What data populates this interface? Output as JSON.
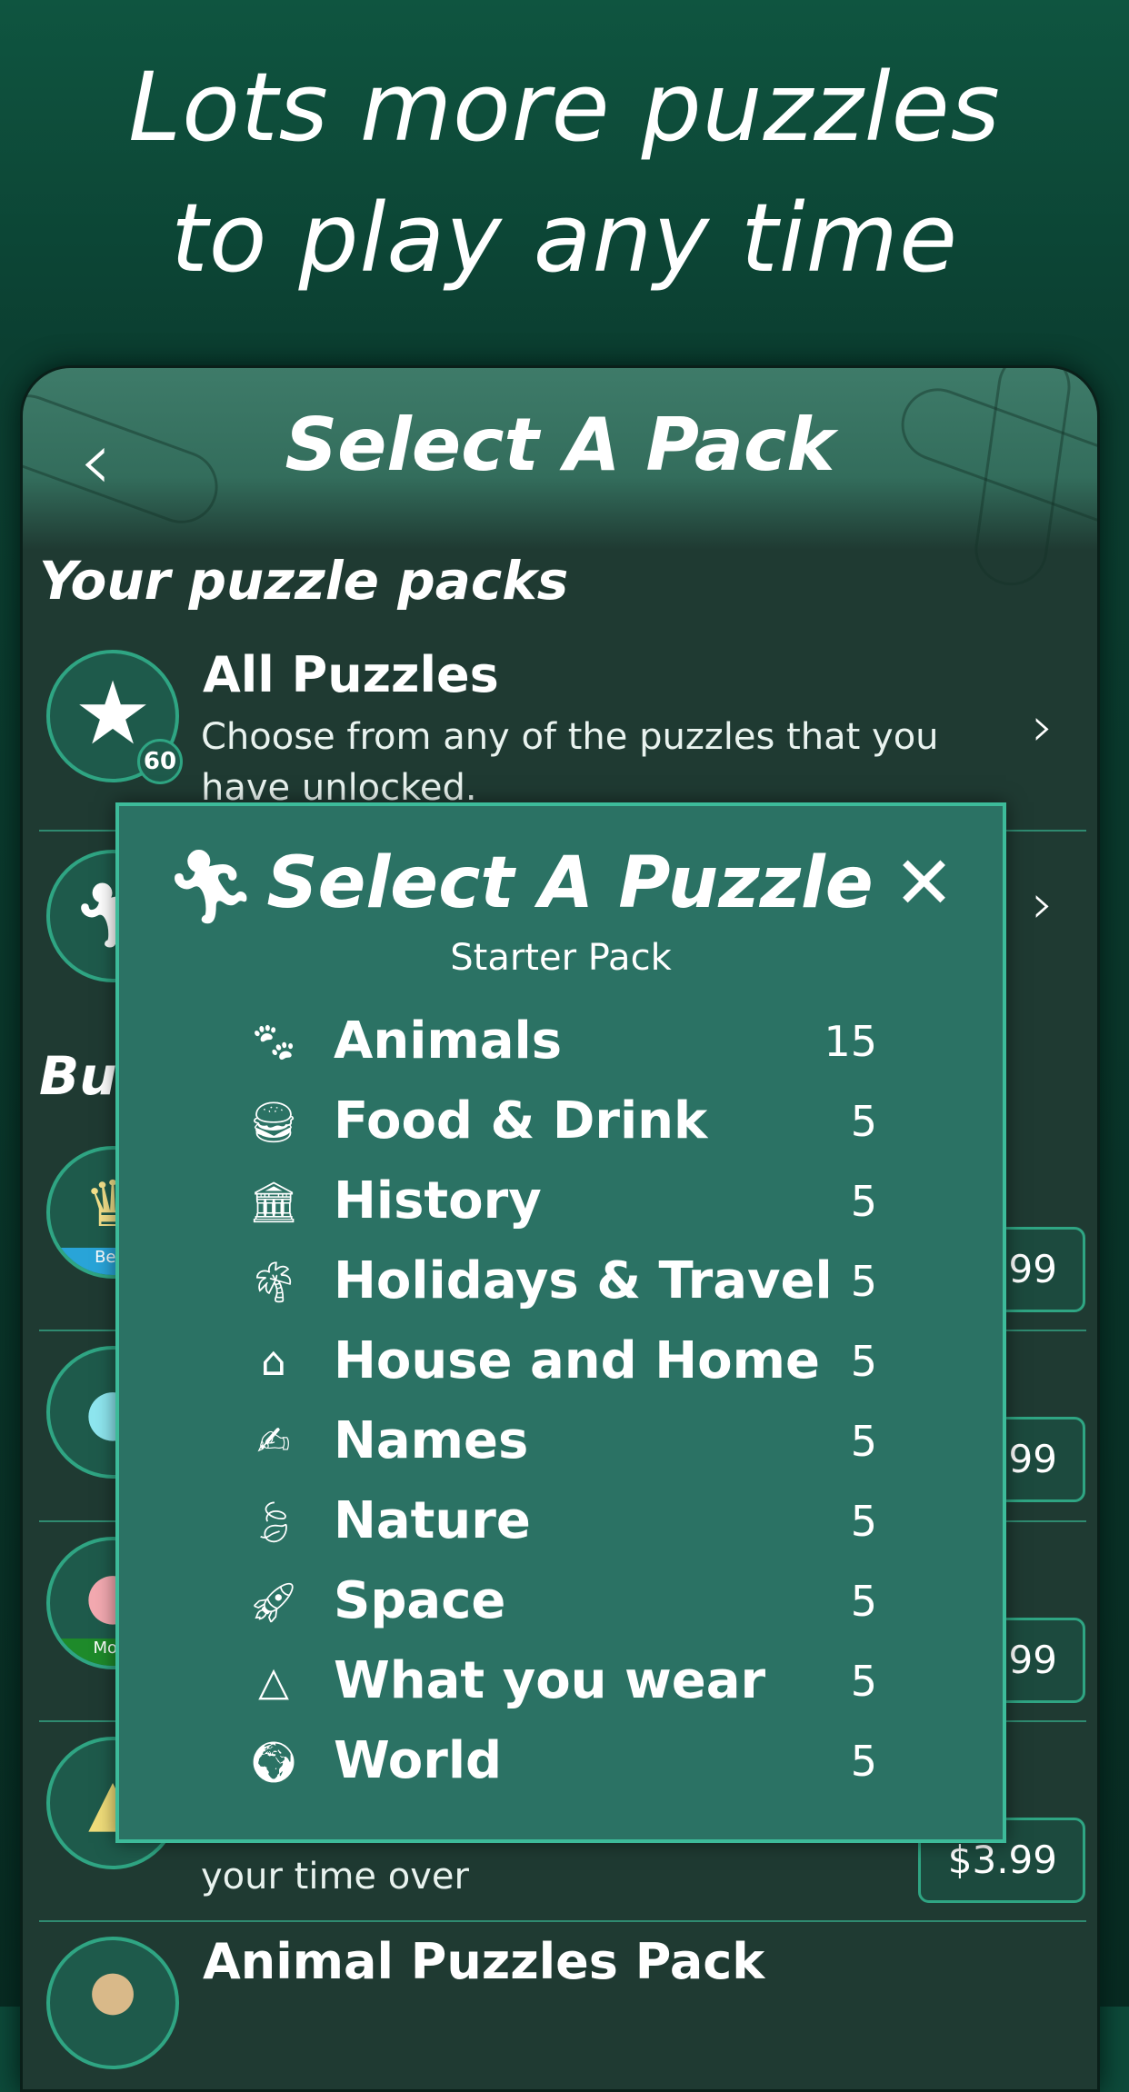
{
  "headline": [
    "Lots more puzzles",
    "to play any time"
  ],
  "screen": {
    "title": "Select A Pack",
    "back_icon": "chevron-left-icon"
  },
  "your_packs": {
    "heading": "Your puzzle packs",
    "items": [
      {
        "title": "All Puzzles",
        "description": "Choose from any of the puzzles that you have unlocked.",
        "badge": "60",
        "icon": "star-icon"
      },
      {
        "icon": "runner-icon"
      }
    ]
  },
  "buy": {
    "heading": "Bu",
    "items": [
      {
        "icon": "crown-icon",
        "ribbon": "Best",
        "price": "99"
      },
      {
        "icon": "balloon-icon",
        "price": "99"
      },
      {
        "icon": "people-icon",
        "ribbon": "Most",
        "price": "99"
      },
      {
        "icon": "palm-tree-icon",
        "description": "your time over",
        "price": "$3.99"
      },
      {
        "icon": "paw-icon",
        "title": "Animal Puzzles Pack"
      }
    ]
  },
  "modal": {
    "title": "Select A Puzzle",
    "subtitle": "Starter Pack",
    "close_icon": "close-icon",
    "pack_icon": "runner-icon",
    "puzzles": [
      {
        "name": "Animals",
        "count": "15",
        "icon": "paw-icon"
      },
      {
        "name": "Food & Drink",
        "count": "5",
        "icon": "food-drink-icon"
      },
      {
        "name": "History",
        "count": "5",
        "icon": "museum-icon"
      },
      {
        "name": "Holidays & Travel",
        "count": "5",
        "icon": "island-icon"
      },
      {
        "name": "House and Home",
        "count": "5",
        "icon": "house-icon"
      },
      {
        "name": "Names",
        "count": "5",
        "icon": "signature-icon"
      },
      {
        "name": "Nature",
        "count": "5",
        "icon": "leaf-icon"
      },
      {
        "name": "Space",
        "count": "5",
        "icon": "rocket-icon"
      },
      {
        "name": "What you wear",
        "count": "5",
        "icon": "hanger-icon"
      },
      {
        "name": "World",
        "count": "5",
        "icon": "globe-icon"
      }
    ]
  },
  "colors": {
    "background": "#0d4a3a",
    "card": "#1f3a32",
    "modal": "#2b7264",
    "accent": "#3dbb9a"
  }
}
